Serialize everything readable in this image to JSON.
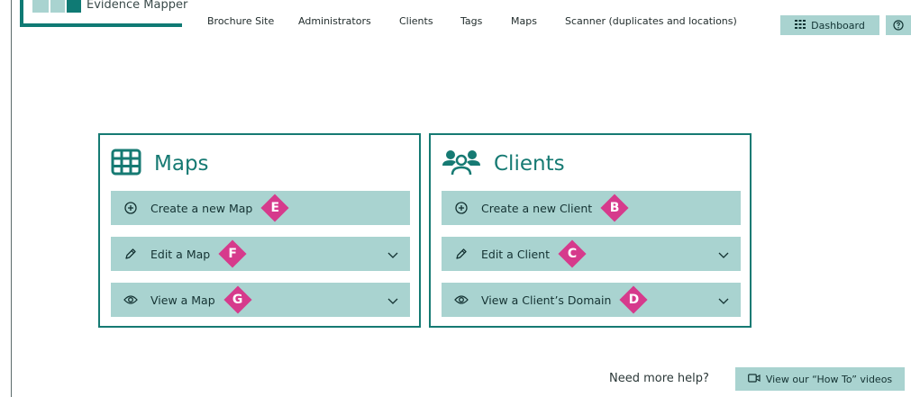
{
  "header": {
    "logo_text": "Evidence Mapper",
    "nav": [
      "Brochure Site",
      "Administrators",
      "Clients",
      "Tags",
      "Maps",
      "Scanner (duplicates and locations)"
    ],
    "dashboard_label": "Dashboard"
  },
  "maps_card": {
    "title": "Maps",
    "rows": [
      {
        "label": "Create a new Map",
        "badge": "E"
      },
      {
        "label": "Edit a Map",
        "badge": "F"
      },
      {
        "label": "View a Map",
        "badge": "G"
      }
    ]
  },
  "clients_card": {
    "title": "Clients",
    "rows": [
      {
        "label": "Create a new Client",
        "badge": "B"
      },
      {
        "label": "Edit a Client",
        "badge": "C"
      },
      {
        "label": "View a Client’s Domain",
        "badge": "D"
      }
    ]
  },
  "help": {
    "text": "Need more help?",
    "button_label": "View our “How To” videos"
  },
  "colors": {
    "teal": "#167a73",
    "light_teal": "#a9d3d0",
    "badge_pink": "#d63a8c"
  }
}
